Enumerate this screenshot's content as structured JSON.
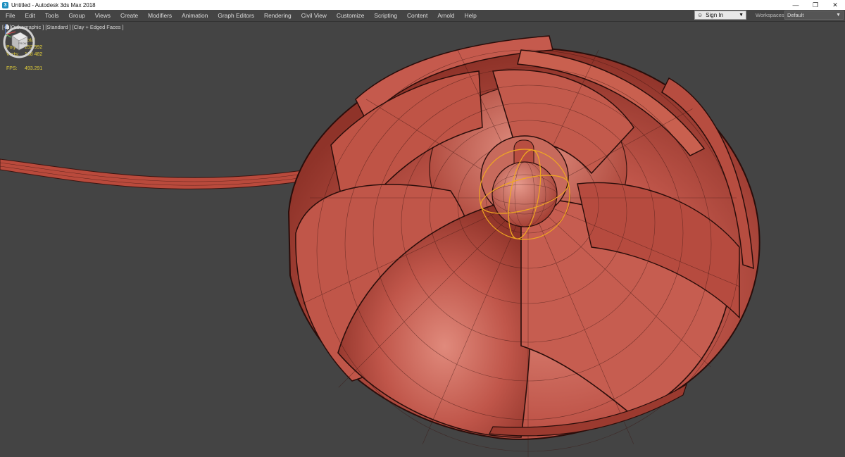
{
  "window": {
    "title": "Untitled - Autodesk 3ds Max 2018",
    "app_icon_glyph": "3",
    "controls": {
      "minimize": "—",
      "restore": "❐",
      "close": "✕"
    }
  },
  "menu": {
    "items": [
      "File",
      "Edit",
      "Tools",
      "Group",
      "Views",
      "Create",
      "Modifiers",
      "Animation",
      "Graph Editors",
      "Rendering",
      "Civil View",
      "Customize",
      "Scripting",
      "Content",
      "Arnold",
      "Help"
    ]
  },
  "account": {
    "sign_in_label": "Sign In",
    "person_icon": "person-icon",
    "arrow": "▼"
  },
  "workspaces": {
    "label": "Workspaces:",
    "selected": "Default",
    "arrow": "▼"
  },
  "viewport": {
    "label": "[+] [Orthographic ] [Standard ] [Clay + Edged Faces ]",
    "stats": {
      "total_header": "Total",
      "polys_label": "Polys:",
      "polys_value": "252 992",
      "verts_label": "Verts:",
      "verts_value": "138 482",
      "fps_label": "FPS:",
      "fps_value": "493.291"
    },
    "viewcube_face": "FRONT",
    "colors": {
      "background": "#444444",
      "clay": "#b94a3c",
      "clay_light": "#d9776a",
      "wire": "#3a1410",
      "gizmo": "#f0a820"
    }
  }
}
